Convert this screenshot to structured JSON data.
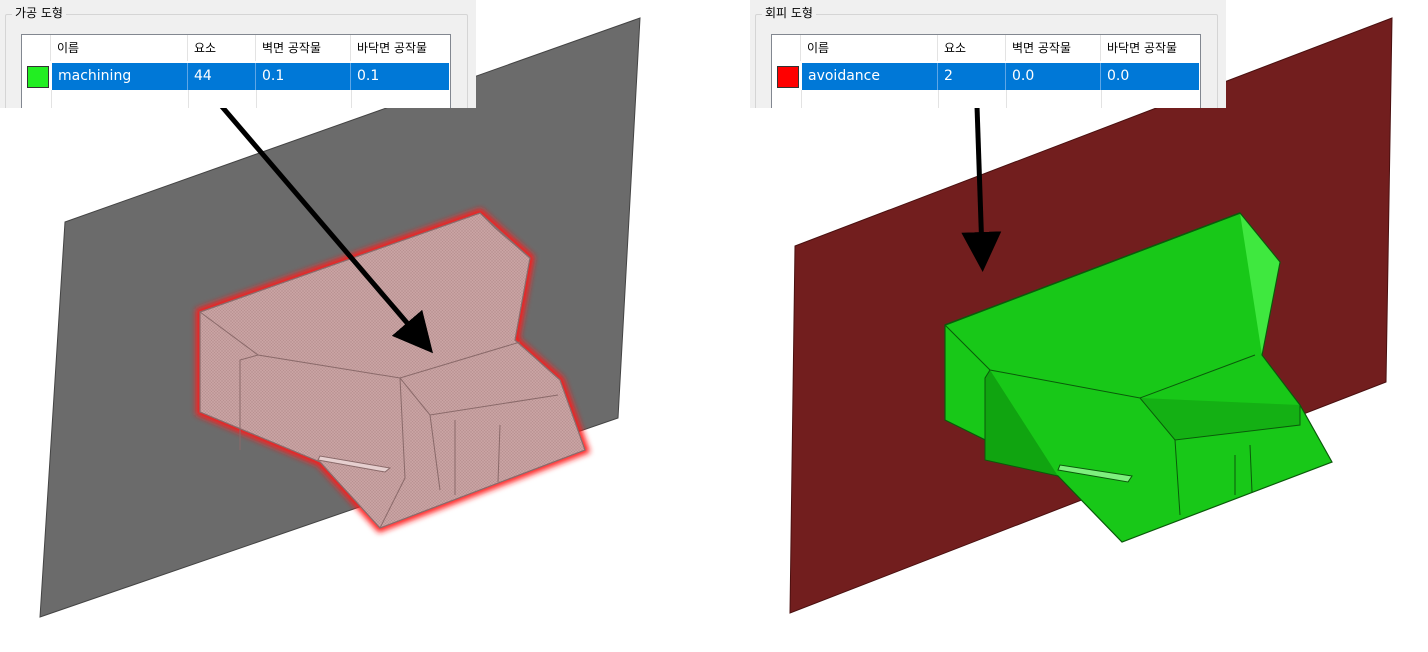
{
  "left_panel": {
    "title": "가공 도형",
    "columns": [
      "이름",
      "요소",
      "벽면 공작물",
      "바닥면 공작물"
    ],
    "row": {
      "color": "#22ee22",
      "name": "machining",
      "elements": "44",
      "wall_stock": "0.1",
      "floor_stock": "0.1"
    }
  },
  "right_panel": {
    "title": "회피 도형",
    "columns": [
      "이름",
      "요소",
      "벽면 공작물",
      "바닥면 공작물"
    ],
    "row": {
      "color": "#ff0000",
      "name": "avoidance",
      "elements": "2",
      "wall_stock": "0.0",
      "floor_stock": "0.0"
    }
  },
  "colors": {
    "selection": "#0078d7",
    "left_plane": "#6b6b6b",
    "left_part": "#c8a0a0",
    "left_outline": "#ff2a2a",
    "right_plane": "#721e1e",
    "right_part": "#22dd22"
  }
}
